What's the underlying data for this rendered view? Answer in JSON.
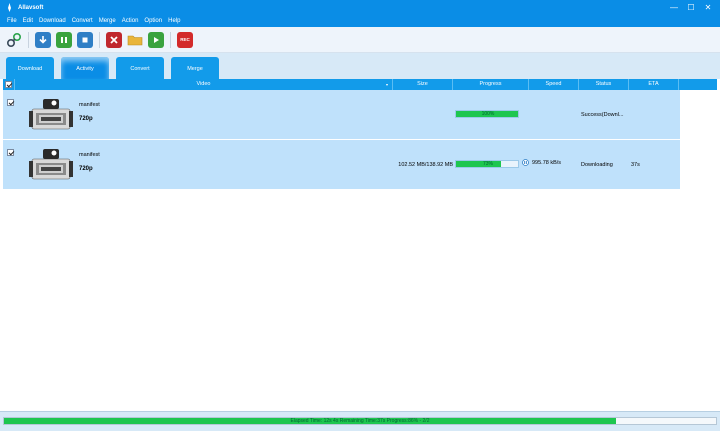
{
  "window": {
    "title": "Allavsoft",
    "controls": [
      "—",
      "☐",
      "✕"
    ]
  },
  "menu": [
    {
      "label": "File"
    },
    {
      "label": "Edit"
    },
    {
      "label": "Download"
    },
    {
      "label": "Convert"
    },
    {
      "label": "Merge"
    },
    {
      "label": "Action"
    },
    {
      "label": "Option"
    },
    {
      "label": "Help"
    }
  ],
  "toolbar": {
    "rec_label": "REC"
  },
  "tabs": [
    {
      "label": "Download"
    },
    {
      "label": "Activity"
    },
    {
      "label": "Convert"
    },
    {
      "label": "Merge"
    }
  ],
  "table": {
    "headers": {
      "video": "Video",
      "size": "Size",
      "progress": "Progress",
      "speed": "Speed",
      "status": "Status",
      "eta": "ETA"
    },
    "rows": [
      {
        "name": "manifest",
        "resolution": "720p",
        "size": "",
        "progress": 100,
        "progress_label": "100%",
        "speed": "",
        "status": "Success(Downl...",
        "eta": ""
      },
      {
        "name": "manifest",
        "resolution": "720p",
        "size": "102.52 MB/138.92 MB",
        "progress": 73,
        "progress_label": "73%",
        "speed": "995.78 kB/s",
        "status": "Downloading",
        "eta": "37s"
      }
    ]
  },
  "statusbar": {
    "text": "Elapsed Time: 12s 4s Remaining Time:37s Progress:86% - 2/2",
    "progress": 86
  },
  "colors": {
    "accent": "#0a8de6",
    "progress": "#1ec64f",
    "row_bg": "#bfe1fb"
  }
}
